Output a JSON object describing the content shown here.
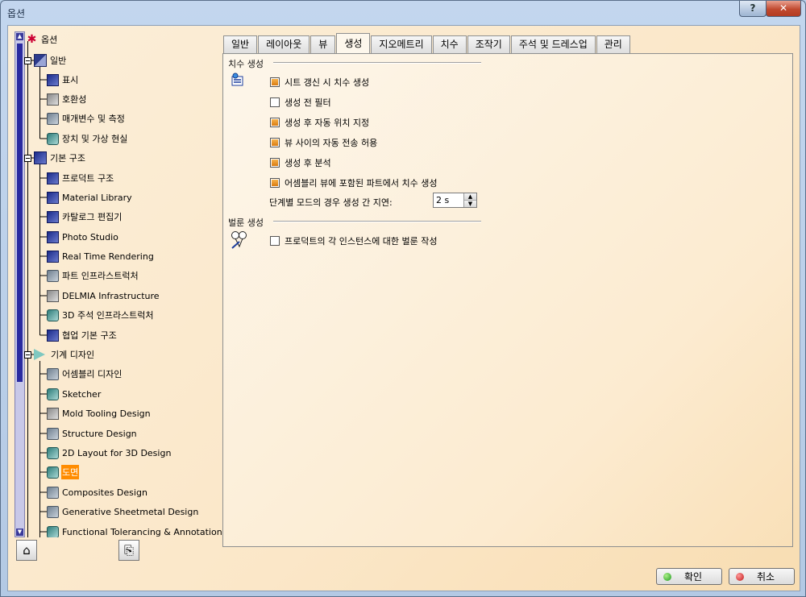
{
  "window": {
    "title": "옵션",
    "help_symbol": "?",
    "close_symbol": "✕"
  },
  "tree": {
    "items": [
      {
        "label": "옵션",
        "icon": "options-root-icon"
      },
      {
        "label": "일반",
        "icon": "general-icon"
      },
      {
        "label": "표시",
        "icon": "display-icon"
      },
      {
        "label": "호환성",
        "icon": "compatibility-icon"
      },
      {
        "label": "매개변수 및 측정",
        "icon": "parameters-icon"
      },
      {
        "label": "장치 및 가상 현실",
        "icon": "devices-icon"
      },
      {
        "label": "기본 구조",
        "icon": "infrastructure-icon"
      },
      {
        "label": "프로덕트 구조",
        "icon": "product-structure-icon"
      },
      {
        "label": "Material Library",
        "icon": "material-library-icon"
      },
      {
        "label": "카탈로그 편집기",
        "icon": "catalog-editor-icon"
      },
      {
        "label": "Photo Studio",
        "icon": "photo-studio-icon"
      },
      {
        "label": "Real Time Rendering",
        "icon": "real-time-rendering-icon"
      },
      {
        "label": "파트 인프라스트럭처",
        "icon": "part-infrastructure-icon"
      },
      {
        "label": "DELMIA Infrastructure",
        "icon": "delmia-icon"
      },
      {
        "label": "3D 주석 인프라스트럭처",
        "icon": "3d-annotation-icon"
      },
      {
        "label": "협업 기본 구조",
        "icon": "collaboration-icon"
      },
      {
        "label": "기계 디자인",
        "icon": "mechanical-design-icon"
      },
      {
        "label": "어셈블리 디자인",
        "icon": "assembly-design-icon"
      },
      {
        "label": "Sketcher",
        "icon": "sketcher-icon"
      },
      {
        "label": "Mold Tooling Design",
        "icon": "mold-tooling-icon"
      },
      {
        "label": "Structure Design",
        "icon": "structure-design-icon"
      },
      {
        "label": "2D Layout for 3D Design",
        "icon": "2d-layout-icon"
      },
      {
        "label": "도면",
        "icon": "drafting-icon"
      },
      {
        "label": "Composites Design",
        "icon": "composites-icon"
      },
      {
        "label": "Generative Sheetmetal Design",
        "icon": "sheetmetal-icon"
      },
      {
        "label": "Functional Tolerancing & Annotation",
        "icon": "tolerancing-icon"
      }
    ]
  },
  "tabs": [
    "일반",
    "레이아웃",
    "뷰",
    "생성",
    "지오메트리",
    "치수",
    "조작기",
    "주석 및 드레스업",
    "관리"
  ],
  "active_tab": "생성",
  "dimension_group": {
    "title": "치수 생성",
    "options": [
      {
        "label": "시트 갱신 시 치수 생성",
        "checked": true
      },
      {
        "label": "생성 전 필터",
        "checked": false
      },
      {
        "label": "생성 후 자동 위치 지정",
        "checked": true
      },
      {
        "label": "뷰 사이의 자동 전송 허용",
        "checked": true
      },
      {
        "label": "생성 후 분석",
        "checked": true
      },
      {
        "label": "어셈블리 뷰에 포함된 파트에서 치수 생성",
        "checked": true
      }
    ],
    "delay_label": "단계별 모드의 경우 생성 간 지연:",
    "delay_value": "2 s"
  },
  "balloon_group": {
    "title": "벌룬 생성",
    "option": {
      "label": "프로덕트의 각 인스턴스에 대한 벌룬 작성",
      "checked": false
    }
  },
  "buttons": {
    "ok": "확인",
    "cancel": "취소"
  },
  "colors": {
    "checkbox_checked": "#e8901e",
    "selected_item": "#ff8c00",
    "panel_background": "#fcebd0"
  }
}
